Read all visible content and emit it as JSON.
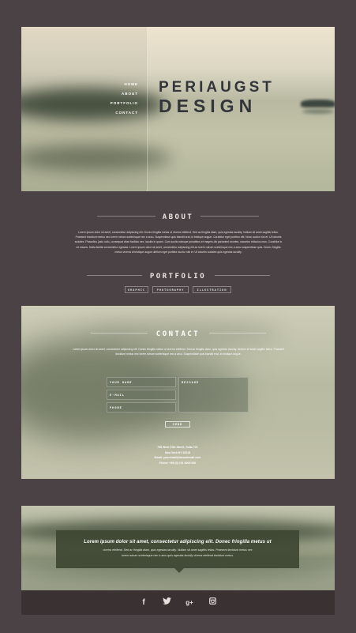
{
  "nav": [
    "HOME",
    "ABOUT",
    "PORTFOLIO",
    "CONTACT"
  ],
  "brand": {
    "line1": "PERIAUGST",
    "line2": "DESIGN"
  },
  "about": {
    "title": "ABOUT",
    "text": "Lorem ipsum dolor sit amet, consectetur adipiscing elit. Donec fringilla metus ut viverra eleifend. Sed ac fringilla diam, quis egestas iaculity. Nullam sit amet sagittis tellus. Praesent tincidunt metus nec lorem rutrum scelerisque nec a arcu. Suspendisse quis blandit erat, id tristique augue. Curabitur eget porttitor elit. Nunc auctor nisl et. Ut lobortis sodales. Phasellus justo odio, consequat vitae facilisis nec, iaculis in quam. Cum sociis natoque penatibus et magnis dis parturient montes, nascetur ridiculus mus. Curabitur in mi mauris. Nulla facilisi consectetur egestas. Lorem ipsum dolor sit amet, consectetur adipiscing elit ac lorem rutrum scelerisque nec a arcu suspendisse quis. Donec fringilla metus viverra id tristique augue ultrilum eget porttitor auctor nisl et. Ut lobortis sodales quis egestas iaculity."
  },
  "portfolio": {
    "title": "PORTFOLIO",
    "buttons": [
      "GRAPHIC",
      "PHOTOGRAPHY",
      "ILLUSTRATION"
    ]
  },
  "contact": {
    "title": "CONTACT",
    "text": "Lorem ipsum dolor sit amet, consectetur adipiscing elit. Donec fringilla metus ut viverra eleifend. Sed ac fringilla diam, quis egestas iaculity. Nullam sit amet sagittis tellus. Praesent tincidunt metus nec lorem rutrum scelerisque nec a arcu. Suspendisse quis blandit erat, id tristique augue.",
    "fields": {
      "name": "YOUR NAME",
      "email": "E-MAIL",
      "phone": "PHONE",
      "message": "MESSAGE"
    },
    "send": "SEND",
    "address": [
      "798 West 21th Street, Suite 721",
      "New York NY 10016",
      "Email: youremail@locustemail.com",
      "Phone: +88 (0) 101 0000 000"
    ]
  },
  "quote": {
    "line1": "Lorem ipsum dolor sit amet, consectetur adipiscing elit. Donec fringilla metus ut",
    "line2": "viverra eleifend. Sed ac fringilla diam, quis egestas iaculity. Nullam sit amet sagittis tellus. Praesent tincidunt metus nec",
    "line3": "lorem rutrum scelerisque nec a arcu quis egestas iaculity viverra eleifend tincidunt metus."
  },
  "social": [
    "f",
    "t",
    "g+",
    "ig"
  ],
  "social_icons": [
    "facebook-icon",
    "twitter-icon",
    "google-plus-icon",
    "instagram-icon"
  ]
}
